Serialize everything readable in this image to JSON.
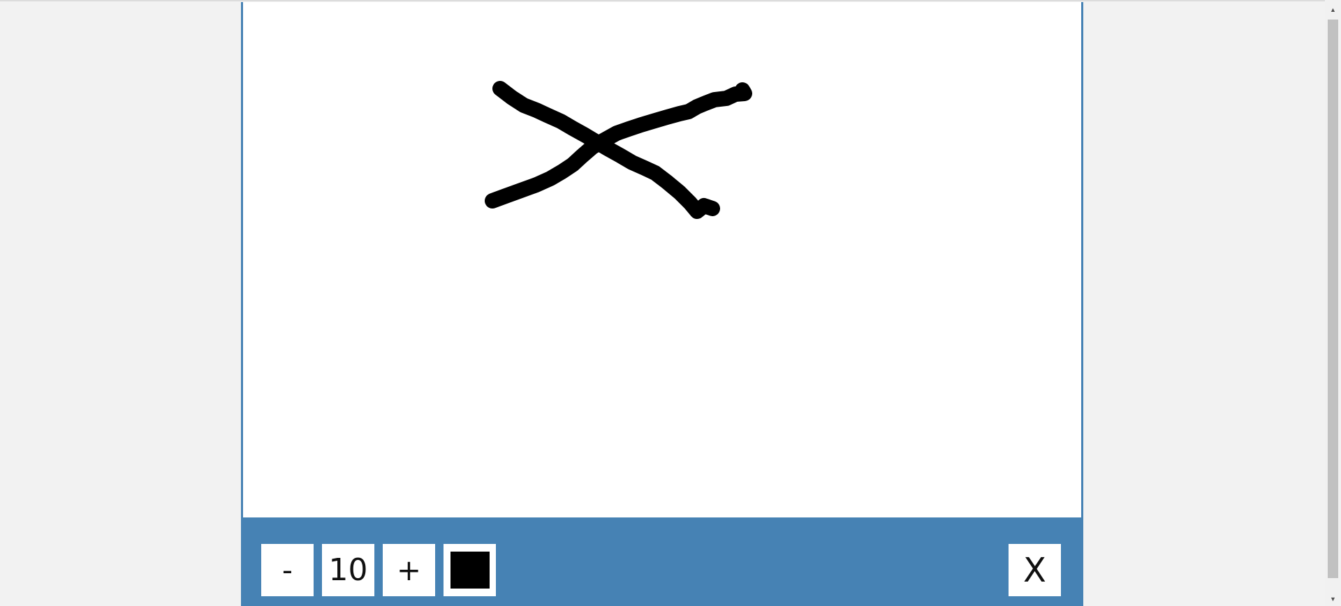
{
  "toolbar": {
    "decrease_label": "-",
    "brush_size": "10",
    "increase_label": "+",
    "close_label": "X",
    "brush_color": "#000000",
    "accent_color": "#4682b4"
  },
  "canvas": {
    "background": "#ffffff",
    "stroke_color": "#000000"
  },
  "icons": {
    "color_swatch": "color-swatch-icon",
    "scroll_up": "scroll-up-arrow-icon",
    "scroll_down": "scroll-down-arrow-icon"
  }
}
